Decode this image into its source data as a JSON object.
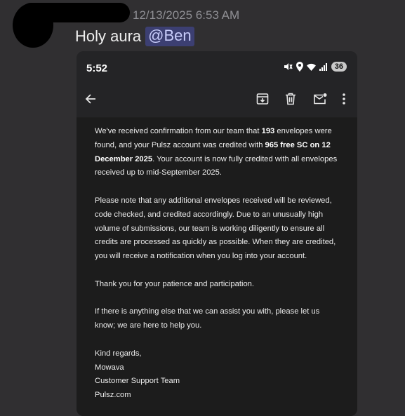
{
  "message": {
    "timestamp": "12/13/2025 6:53 AM",
    "text": "Holy aura",
    "mention": "@Ben"
  },
  "phone": {
    "status_time": "5:52",
    "battery_level": "36",
    "toolbar_icons": [
      "back-arrow-icon",
      "archive-icon",
      "delete-icon",
      "mark-unread-icon",
      "more-vert-icon"
    ]
  },
  "email": {
    "p1_a": "We've received confirmation from our team that ",
    "p1_b": "193",
    "p1_c": " envelopes were found, and your Pulsz account was credited with ",
    "p1_d": "965 free SC on 12 December 2025",
    "p1_e": ". Your account is now fully credited with all envelopes received up to mid-September 2025.",
    "p2": "Please note that any additional envelopes received will be reviewed, code checked, and credited accordingly. Due to an unusually high volume of submissions, our team is working diligently to ensure all credits are processed as quickly as possible. When they are credited, you will receive a notification when you log into your account.",
    "p3": "Thank you for your patience and participation.",
    "p4": "If there is anything else that we can assist you with, please let us know; we are here to help you.",
    "signoff": "Kind regards,",
    "sender": "Mowava",
    "team": "Customer Support Team",
    "site": "Pulsz.com"
  }
}
